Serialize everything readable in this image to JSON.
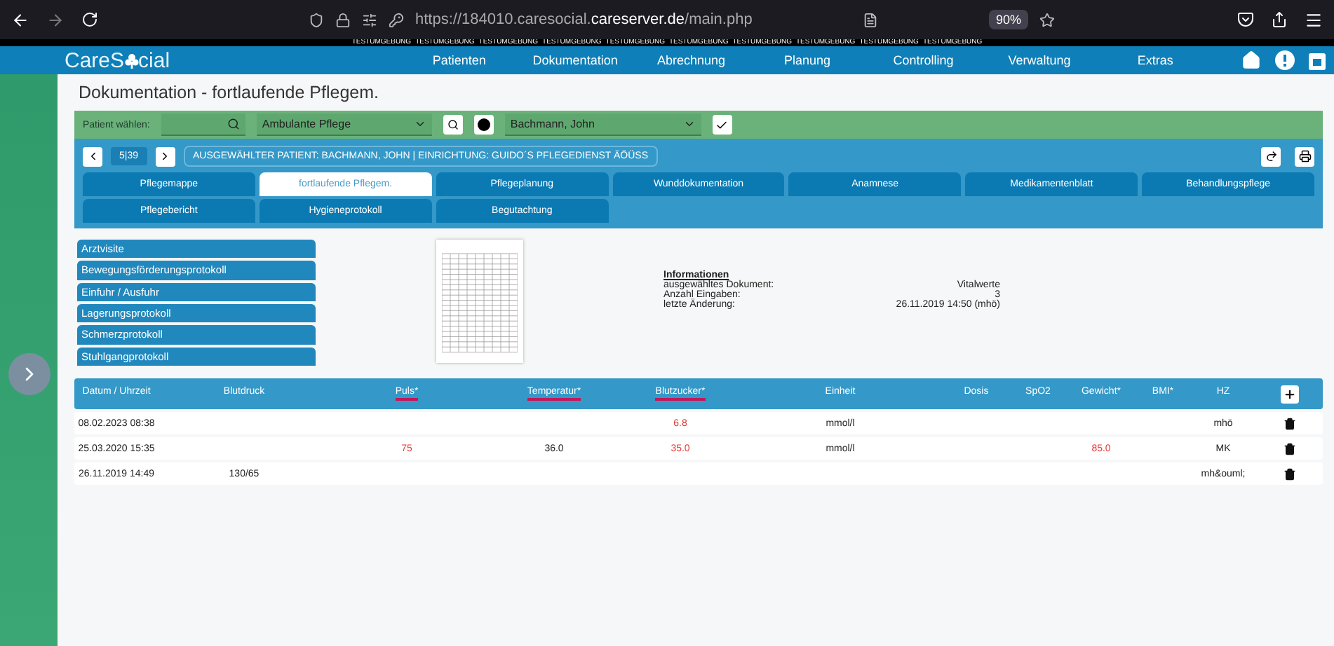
{
  "browser": {
    "url": "https://184010.caresocial.**careserver.de**/main.php",
    "zoom": "90%"
  },
  "banner": [
    "TESTUMGEBUNG",
    "TESTUMGEBUNG",
    "TESTUMGEBUNG",
    "TESTUMGEBUNG",
    "TESTUMGEBUNG",
    "TESTUMGEBUNG",
    "TESTUMGEBUNG",
    "TESTUMGEBUNG",
    "TESTUMGEBUNG",
    "TESTUMGEBUNG"
  ],
  "app": {
    "logo_start": "CareS",
    "logo_end": "cial",
    "nav": [
      "Patienten",
      "Dokumentation",
      "Abrechnung",
      "Planung",
      "Controlling",
      "Verwaltung",
      "Extras"
    ]
  },
  "page_title": "Dokumentation - fortlaufende Pflegem.",
  "patient_bar": {
    "label": "Patient wählen:",
    "facility": "Ambulante Pflege",
    "patient": "Bachmann, John"
  },
  "pager": {
    "position": "5|39",
    "info": "AUSGEWÄHLTER PATIENT: BACHMANN, JOHN | EINRICHTUNG: GUIDO´S PFLEGEDIENST ÄÖÜSS"
  },
  "tabs": [
    {
      "label": "Pflegemappe",
      "selected": false
    },
    {
      "label": "fortlaufende Pflegem.",
      "selected": true
    },
    {
      "label": "Pflegeplanung",
      "selected": false
    },
    {
      "label": "Wunddokumentation",
      "selected": false
    },
    {
      "label": "Anamnese",
      "selected": false
    },
    {
      "label": "Medikamentenblatt",
      "selected": false
    },
    {
      "label": "Behandlungspflege",
      "selected": false
    },
    {
      "label": "Pflegebericht",
      "selected": false
    },
    {
      "label": "Hygieneprotokoll",
      "selected": false
    },
    {
      "label": "Begutachtung",
      "selected": false
    }
  ],
  "documents": [
    "Arztvisite",
    "Bewegungsförderungsprotokoll",
    "Einfuhr / Ausfuhr",
    "Lagerungsprotokoll",
    "Schmerzprotokoll",
    "Stuhlgangprotokoll"
  ],
  "info": {
    "heading": "Informationen",
    "rows": [
      {
        "label": "ausgewähltes Dokument:",
        "value": "Vitalwerte"
      },
      {
        "label": "Anzahl Eingaben:",
        "value": "3"
      },
      {
        "label": "letzte Änderung:",
        "value": "26.11.2019 14:50 (mhö)"
      }
    ]
  },
  "table": {
    "columns": [
      {
        "label": "Datum / Uhrzeit",
        "marked": false
      },
      {
        "label": "Blutdruck",
        "marked": false
      },
      {
        "label": "Puls*",
        "marked": true
      },
      {
        "label": "Temperatur*",
        "marked": true
      },
      {
        "label": "Blutzucker*",
        "marked": true
      },
      {
        "label": "Einheit",
        "marked": false
      },
      {
        "label": "Dosis",
        "marked": false
      },
      {
        "label": "SpO2",
        "marked": false
      },
      {
        "label": "Gewicht*",
        "marked": false
      },
      {
        "label": "BMI*",
        "marked": false
      },
      {
        "label": "HZ",
        "marked": false
      }
    ],
    "rows": [
      {
        "datum": {
          "text": "08.02.2023 08:38",
          "flagged": false
        },
        "blutzucker": {
          "text": "6.8",
          "flagged": true
        },
        "einheit": {
          "text": "mmol/l",
          "flagged": false
        },
        "hz": {
          "text": "mhö",
          "flagged": false
        }
      },
      {
        "datum": {
          "text": "25.03.2020 15:35",
          "flagged": false
        },
        "puls": {
          "text": "75",
          "flagged": true
        },
        "temperatur": {
          "text": "36.0",
          "flagged": false
        },
        "blutzucker": {
          "text": "35.0",
          "flagged": true
        },
        "einheit": {
          "text": "mmol/l",
          "flagged": false
        },
        "gewicht": {
          "text": "85.0",
          "flagged": true
        },
        "hz": {
          "text": "MK",
          "flagged": false
        }
      },
      {
        "datum": {
          "text": "26.11.2019 14:49",
          "flagged": false
        },
        "blutdruck": {
          "text": "130/65",
          "flagged": false
        },
        "hz": {
          "text": "mh&ouml;",
          "flagged": false
        }
      }
    ]
  }
}
